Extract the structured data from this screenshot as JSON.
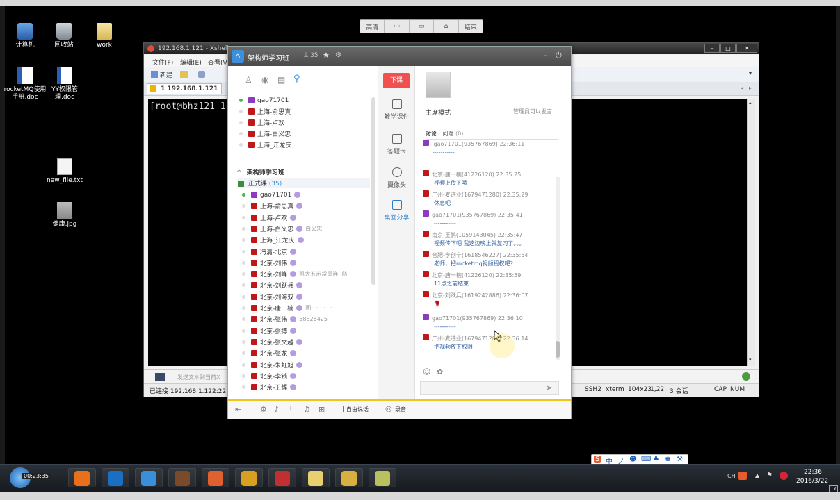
{
  "record_toolbar": {
    "items": [
      "高清",
      "⬚",
      "▭",
      "⌂",
      "结束"
    ]
  },
  "desktop_icons": [
    {
      "label": "计算机",
      "icon": "computer-icon"
    },
    {
      "label": "回收站",
      "icon": "recycle-bin-icon"
    },
    {
      "label": "work",
      "icon": "folder-icon"
    },
    {
      "label": "rocketMQ使用手册.doc",
      "icon": "word-doc-icon"
    },
    {
      "label": "YY权限管理.doc",
      "icon": "word-doc-icon"
    },
    {
      "label": "new_file.txt",
      "icon": "text-file-icon"
    },
    {
      "label": "健康.jpg",
      "icon": "image-file-icon"
    }
  ],
  "xshell": {
    "title": "192.168.1.121 - Xshell",
    "menu": [
      "文件(F)",
      "编辑(E)",
      "查看(V"
    ],
    "toolbar_new": "新建",
    "tab_label": "1 192.168.1.121",
    "terminal_line": "[root@bhz121 1",
    "input_placeholder": "发送文本到当前X",
    "status": {
      "connected": "已连接 192.168.1.122:22.",
      "protocol": "SSH2",
      "term": "xterm",
      "size": "104x23",
      "cursor": "1,22",
      "sessions": "3 会话",
      "caps": "CAP",
      "num": "NUM"
    }
  },
  "yy": {
    "title": "架构师学习班",
    "count": "35",
    "pinned_members": [
      {
        "name": "gao71701",
        "gem": "purple",
        "online": true
      },
      {
        "name": "上海-俞思真",
        "gem": "red",
        "online": false
      },
      {
        "name": "上海-卢欢",
        "gem": "red",
        "online": false
      },
      {
        "name": "上海-白义忠",
        "gem": "red",
        "online": false
      },
      {
        "name": "上海_江龙庆",
        "gem": "red",
        "online": false
      }
    ],
    "group_name": "架构师学习班",
    "channel_name": "正式课",
    "channel_count": "(35)",
    "members": [
      {
        "name": "gao71701",
        "gem": "purple",
        "online": true,
        "note": ""
      },
      {
        "name": "上海-俞思真",
        "gem": "red",
        "online": false,
        "note": ""
      },
      {
        "name": "上海-卢欢",
        "gem": "red",
        "online": false,
        "note": ""
      },
      {
        "name": "上海-白义忠",
        "gem": "red",
        "online": false,
        "note": "白义忠"
      },
      {
        "name": "上海_江龙庆",
        "gem": "red",
        "online": false,
        "note": ""
      },
      {
        "name": "冯清-北京",
        "gem": "red",
        "online": false,
        "note": ""
      },
      {
        "name": "北京-刘伟",
        "gem": "red",
        "online": false,
        "note": ""
      },
      {
        "name": "北京-刘峰",
        "gem": "red",
        "online": false,
        "note": "凯大五示常墨连, 舫"
      },
      {
        "name": "北京-刘跃兵",
        "gem": "red",
        "online": false,
        "note": ""
      },
      {
        "name": "北京-刘海双",
        "gem": "red",
        "online": false,
        "note": ""
      },
      {
        "name": "北京-唐一楠",
        "gem": "red",
        "online": false,
        "note": "图 · · · · · ·"
      },
      {
        "name": "北京-张伟",
        "gem": "red",
        "online": false,
        "note": "58826425"
      },
      {
        "name": "北京-张搏",
        "gem": "red",
        "online": false,
        "note": ""
      },
      {
        "name": "北京-张文越",
        "gem": "red",
        "online": false,
        "note": ""
      },
      {
        "name": "北京-张龙",
        "gem": "red",
        "online": false,
        "note": ""
      },
      {
        "name": "北京-朱虹旭",
        "gem": "red",
        "online": false,
        "note": ""
      },
      {
        "name": "北京-李锁",
        "gem": "red",
        "online": false,
        "note": ""
      },
      {
        "name": "北京-王辉",
        "gem": "red",
        "online": false,
        "note": ""
      }
    ],
    "mid_buttons": {
      "stop": "下课",
      "items": [
        "教学课件",
        "答题卡",
        "摄像头",
        "桌面分享"
      ]
    },
    "mode": "主席模式",
    "admin_only": "管理员可以发言",
    "tabs": {
      "discuss": "讨论",
      "questions": "问题",
      "q_count": "(0)"
    },
    "pinned_message": {
      "meta": "gao71701(935767869) 22:36:11",
      "body": "-----------"
    },
    "messages": [
      {
        "meta": "北京-唐一楠(41226120) 22:35:25",
        "body": "视频上传下哦",
        "gem": "red"
      },
      {
        "meta": "广州-麦进业(1679471280) 22:35:29",
        "body": "休息吧",
        "gem": "red"
      },
      {
        "meta": "gao71701(935767869) 22:35:41",
        "body": "-----------",
        "gem": "purple"
      },
      {
        "meta": "南京-王鹏(1059143045) 22:35:47",
        "body": "视频传下吧 我这边晚上就复习了。。。",
        "gem": "red"
      },
      {
        "meta": "合肥-李创辛(1618546227) 22:35:54",
        "body": "老师，把rocketmq视频授权吧？",
        "gem": "red"
      },
      {
        "meta": "北京-唐一楠(41226120) 22:35:59",
        "body": "11点之前结束",
        "gem": "red"
      },
      {
        "meta": "北京-刘跃兵(1619242886) 22:36:07",
        "body": "🌹",
        "gem": "red"
      },
      {
        "meta": "gao71701(935767869) 22:36:10",
        "body": "-----------",
        "gem": "purple"
      },
      {
        "meta": "广州-麦进业(1679471280) 22:36:14",
        "body": "把视频放下权限",
        "gem": "red"
      }
    ],
    "bottom": {
      "free_talk": "自由说话",
      "record": "录音"
    }
  },
  "taskbar": {
    "clock_overlay": "00:23:35",
    "apps": [
      "firefox-icon",
      "virtualbox-icon",
      "app-icon",
      "game-icon",
      "powerpoint-icon",
      "mask-icon",
      "snail-icon",
      "explorer-icon",
      "chat-icon",
      "notes-icon"
    ],
    "lang": "CH",
    "time": "22:36",
    "date": "2016/3/22",
    "corner": "1x"
  },
  "ime": {
    "items": [
      "S",
      "中",
      "ノ",
      "☻",
      "⌨",
      "♣",
      "♚",
      "⚒"
    ]
  },
  "colors": {
    "yy_stop": "#f05050",
    "accent": "#2e5fa0",
    "gem_red": "#c01818",
    "gem_purple": "#8a3bc2"
  }
}
